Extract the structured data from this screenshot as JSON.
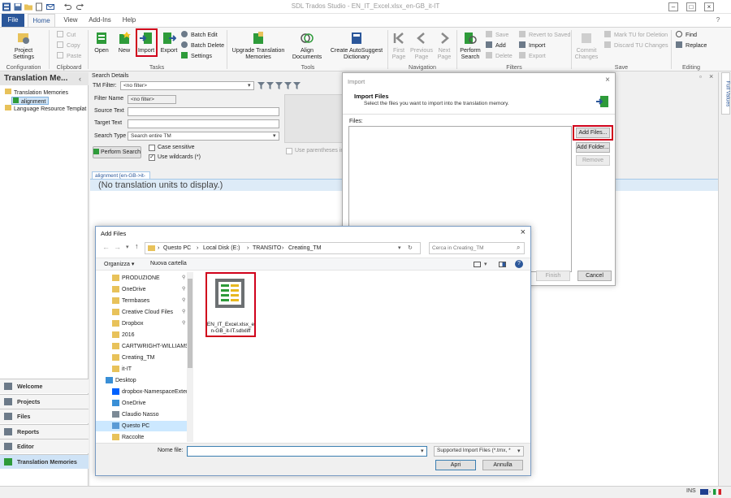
{
  "window": {
    "title": "SDL Trados Studio - EN_IT_Excel.xlsx_en-GB_it-IT",
    "controls": [
      "–",
      "□",
      "×"
    ]
  },
  "menu": {
    "file": "File",
    "home": "Home",
    "view": "View",
    "addins": "Add-Ins",
    "help": "Help"
  },
  "ribbon": {
    "configuration": {
      "project_settings_1": "Project",
      "project_settings_2": "Settings",
      "group": "Configuration"
    },
    "clipboard": {
      "cut": "Cut",
      "copy": "Copy",
      "paste": "Paste",
      "group": "Clipboard"
    },
    "tasks": {
      "open": "Open",
      "new": "New",
      "import": "Import",
      "export": "Export",
      "batch_edit": "Batch Edit",
      "batch_delete": "Batch Delete",
      "settings": "Settings",
      "group": "Tasks"
    },
    "tools": {
      "upgrade_1": "Upgrade Translation",
      "upgrade_2": "Memories",
      "align_1": "Align",
      "align_2": "Documents",
      "autosuggest_1": "Create AutoSuggest",
      "autosuggest_2": "Dictionary",
      "group": "Tools"
    },
    "navigation": {
      "first_1": "First",
      "first_2": "Page",
      "previous_1": "Previous",
      "previous_2": "Page",
      "next_1": "Next",
      "next_2": "Page",
      "group": "Navigation"
    },
    "filters": {
      "perform_1": "Perform",
      "perform_2": "Search",
      "save": "Save",
      "add": "Add",
      "delete": "Delete",
      "revert": "Revert to Saved",
      "import": "Import",
      "export": "Export",
      "group": "Filters"
    },
    "save": {
      "commit_1": "Commit",
      "commit_2": "Changes",
      "mark_tu": "Mark TU for Deletion",
      "discard_tu": "Discard TU Changes",
      "group": "Save"
    },
    "editing": {
      "find": "Find",
      "replace": "Replace",
      "group": "Editing"
    }
  },
  "left_panel": {
    "title": "Translation Me...",
    "tree": {
      "root": "Translation Memories",
      "alignment": "alignment",
      "lr_templates": "Language Resource Templat"
    },
    "nav": [
      "Welcome",
      "Projects",
      "Files",
      "Reports",
      "Editor",
      "Translation Memories"
    ]
  },
  "search": {
    "header": "Search Details",
    "tm_filter_label": "TM Filter:",
    "tm_filter_value": "<no filter>",
    "filter_name_label": "Filter Name",
    "filter_name_value": "<no filter>",
    "source_text_label": "Source Text",
    "target_text_label": "Target Text",
    "search_type_label": "Search Type",
    "search_type_value": "Search entire TM",
    "case_sensitive": "Case sensitive",
    "use_wildcards": "Use wildcards (*)",
    "perform_search": "Perform Search",
    "use_parentheses": "Use parentheses in fi"
  },
  "tm_tab": {
    "label": "alignment [en-GB->it-IT]",
    "empty": "(No translation units to display.)"
  },
  "right_rail": {
    "full_values": "Full Values"
  },
  "status": {
    "ins": "INS"
  },
  "import_dialog": {
    "title": "Import",
    "heading": "Import Files",
    "subheading": "Select the files you want to import into the translation memory.",
    "files_label": "Files:",
    "add_files": "Add Files...",
    "add_folder": "Add Folder...",
    "remove": "Remove",
    "finish": "Finish",
    "cancel": "Cancel"
  },
  "add_files_dialog": {
    "title": "Add Files",
    "breadcrumbs": [
      "Questo PC",
      "Local Disk (E:)",
      "TRANSITO",
      "Creating_TM"
    ],
    "search_placeholder": "Cerca in Creating_TM",
    "organize": "Organizza",
    "new_folder": "Nuova cartella",
    "nav_items": [
      {
        "label": "PRODUZIONE",
        "icon": "folder-icon",
        "pinned": true
      },
      {
        "label": "OneDrive",
        "icon": "folder-icon",
        "pinned": true
      },
      {
        "label": "Termbases",
        "icon": "folder-icon",
        "pinned": true
      },
      {
        "label": "Creative Cloud Files",
        "icon": "folder-icon",
        "pinned": true
      },
      {
        "label": "Dropbox",
        "icon": "folder-icon",
        "pinned": true
      },
      {
        "label": "2016",
        "icon": "folder-icon",
        "pinned": false
      },
      {
        "label": "CARTWRIGHT-WILLIAMS-İ",
        "icon": "folder-icon",
        "pinned": false
      },
      {
        "label": "Creating_TM",
        "icon": "folder-icon",
        "pinned": false
      },
      {
        "label": "it-IT",
        "icon": "folder-icon",
        "pinned": false
      },
      {
        "label": "Desktop",
        "icon": "desktop-icon",
        "pinned": false
      },
      {
        "label": "dropbox-NamespaceExten",
        "icon": "dropbox-icon",
        "pinned": false
      },
      {
        "label": "OneDrive",
        "icon": "cloud-icon",
        "pinned": false
      },
      {
        "label": "Claudio Nasso",
        "icon": "user-icon",
        "pinned": false
      },
      {
        "label": "Questo PC",
        "icon": "computer-icon",
        "pinned": false
      },
      {
        "label": "Raccolte",
        "icon": "folder-icon",
        "pinned": false
      }
    ],
    "file_name_1": "EN_IT_Excel.xlsx_e",
    "file_name_2": "n-GB_it-IT.sdlxliff",
    "filename_label": "Nome file:",
    "filename_value": "",
    "filetype": "Supported Import Files (*.tmx, *",
    "open": "Apri",
    "cancel": "Annulla"
  },
  "colors": {
    "accent": "#2b579a",
    "highlight": "#d0021b",
    "icon_green": "#2e9b3a",
    "folder": "#e8c25a"
  }
}
